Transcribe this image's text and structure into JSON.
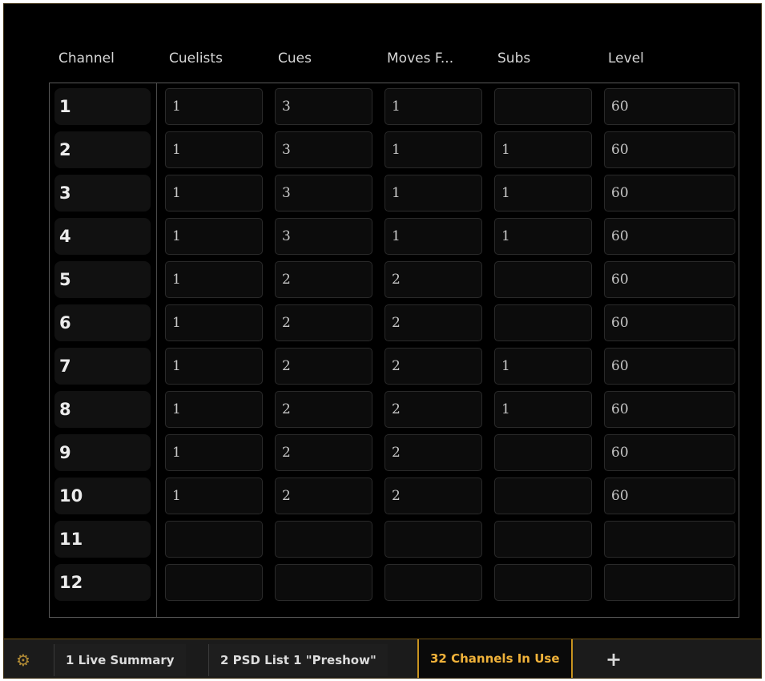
{
  "columns": {
    "channel": "Channel",
    "cuelists": "Cuelists",
    "cues": "Cues",
    "moves": "Moves F...",
    "subs": "Subs",
    "level": "Level"
  },
  "rows": [
    {
      "channel": "1",
      "cuelists": "1",
      "cues": "3",
      "moves": "1",
      "subs": "",
      "level": "60"
    },
    {
      "channel": "2",
      "cuelists": "1",
      "cues": "3",
      "moves": "1",
      "subs": "1",
      "level": "60"
    },
    {
      "channel": "3",
      "cuelists": "1",
      "cues": "3",
      "moves": "1",
      "subs": "1",
      "level": "60"
    },
    {
      "channel": "4",
      "cuelists": "1",
      "cues": "3",
      "moves": "1",
      "subs": "1",
      "level": "60"
    },
    {
      "channel": "5",
      "cuelists": "1",
      "cues": "2",
      "moves": "2",
      "subs": "",
      "level": "60"
    },
    {
      "channel": "6",
      "cuelists": "1",
      "cues": "2",
      "moves": "2",
      "subs": "",
      "level": "60"
    },
    {
      "channel": "7",
      "cuelists": "1",
      "cues": "2",
      "moves": "2",
      "subs": "1",
      "level": "60"
    },
    {
      "channel": "8",
      "cuelists": "1",
      "cues": "2",
      "moves": "2",
      "subs": "1",
      "level": "60"
    },
    {
      "channel": "9",
      "cuelists": "1",
      "cues": "2",
      "moves": "2",
      "subs": "",
      "level": "60"
    },
    {
      "channel": "10",
      "cuelists": "1",
      "cues": "2",
      "moves": "2",
      "subs": "",
      "level": "60"
    },
    {
      "channel": "11",
      "cuelists": "",
      "cues": "",
      "moves": "",
      "subs": "",
      "level": ""
    },
    {
      "channel": "12",
      "cuelists": "",
      "cues": "",
      "moves": "",
      "subs": "",
      "level": ""
    }
  ],
  "tabs": [
    {
      "label": "1 Live Summary",
      "active": false
    },
    {
      "label": "2 PSD List 1 \"Preshow\"",
      "active": false
    },
    {
      "label": "32 Channels In Use",
      "active": true
    }
  ],
  "icons": {
    "settings": "gear-icon",
    "add_tab": "plus-icon"
  },
  "add_tab_symbol": "+",
  "colors": {
    "accent": "#f0b23a",
    "background": "#000000",
    "tab_border": "#c8931f"
  }
}
